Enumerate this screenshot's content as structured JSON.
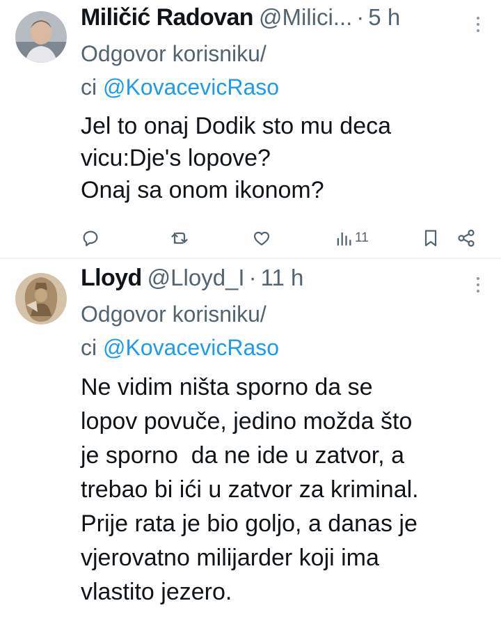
{
  "tweets": [
    {
      "author": "Miličić Radovan",
      "handle": "@Milici...",
      "separator": "·",
      "time": "5 h",
      "reply_prefix": "Odgovor korisniku/",
      "reply_prefix2": "ci",
      "reply_to": "@KovacevicRaso",
      "text": "Jel to onaj Dodik sto mu deca\nvicu:Dje's lopove?\nOnaj sa onom ikonom?",
      "views": "11"
    },
    {
      "author": "Lloyd",
      "handle": "@Lloyd_I",
      "separator": "·",
      "time": "11 h",
      "reply_prefix": "Odgovor korisniku/",
      "reply_prefix2": "ci",
      "reply_to": "@KovacevicRaso",
      "text": "Ne vidim ništa sporno da se\nlopov povuče, jedino možda što\nje sporno  da ne ide u zatvor, a\ntrebao bi ići u zatvor za kriminal.\nPrije rata je bio goljo, a danas je\nvjerovatno milijarder koji ima\nvlastito jezero."
    }
  ],
  "icons": {
    "reply": "reply-icon",
    "retweet": "retweet-icon",
    "like": "heart-icon",
    "views": "views-icon",
    "bookmark": "bookmark-icon",
    "share": "share-icon",
    "more": "more-icon"
  },
  "colors": {
    "text": "#0f1419",
    "secondary": "#536471",
    "link": "#1d9bf0",
    "divider": "#eff3f4"
  }
}
